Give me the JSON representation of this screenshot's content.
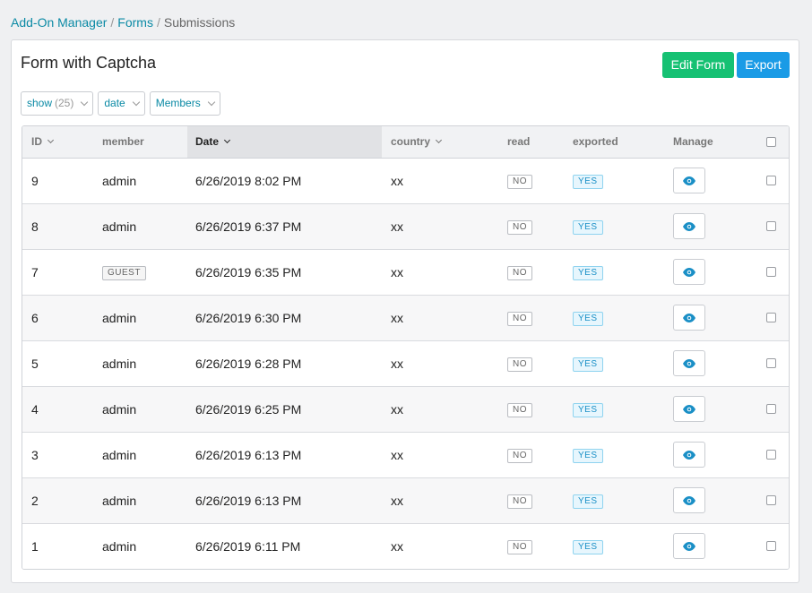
{
  "breadcrumb": {
    "item1": "Add-On Manager",
    "item2": "Forms",
    "current": "Submissions",
    "separator": "/"
  },
  "page": {
    "title": "Form with Captcha"
  },
  "buttons": {
    "edit_form": "Edit Form",
    "export": "Export"
  },
  "filters": {
    "show_label": "show",
    "show_count": "(25)",
    "date_label": "date",
    "members_label": "Members"
  },
  "columns": {
    "id": "ID",
    "member": "member",
    "date": "Date",
    "country": "country",
    "read": "read",
    "exported": "exported",
    "manage": "Manage"
  },
  "rows": [
    {
      "id": "9",
      "member": "admin",
      "date": "6/26/2019 8:02 PM",
      "country": "xx",
      "read": "NO",
      "exported": "YES"
    },
    {
      "id": "8",
      "member": "admin",
      "date": "6/26/2019 6:37 PM",
      "country": "xx",
      "read": "NO",
      "exported": "YES"
    },
    {
      "id": "7",
      "member": "GUEST",
      "member_badge": true,
      "date": "6/26/2019 6:35 PM",
      "country": "xx",
      "read": "NO",
      "exported": "YES"
    },
    {
      "id": "6",
      "member": "admin",
      "date": "6/26/2019 6:30 PM",
      "country": "xx",
      "read": "NO",
      "exported": "YES"
    },
    {
      "id": "5",
      "member": "admin",
      "date": "6/26/2019 6:28 PM",
      "country": "xx",
      "read": "NO",
      "exported": "YES"
    },
    {
      "id": "4",
      "member": "admin",
      "date": "6/26/2019 6:25 PM",
      "country": "xx",
      "read": "NO",
      "exported": "YES"
    },
    {
      "id": "3",
      "member": "admin",
      "date": "6/26/2019 6:13 PM",
      "country": "xx",
      "read": "NO",
      "exported": "YES"
    },
    {
      "id": "2",
      "member": "admin",
      "date": "6/26/2019 6:13 PM",
      "country": "xx",
      "read": "NO",
      "exported": "YES"
    },
    {
      "id": "1",
      "member": "admin",
      "date": "6/26/2019 6:11 PM",
      "country": "xx",
      "read": "NO",
      "exported": "YES"
    }
  ],
  "icons": {
    "view": "eye-icon",
    "sort": "chevron-down-icon"
  },
  "colors": {
    "link": "#0b8aa5",
    "edit_button": "#16c173",
    "export_button": "#1a9be6"
  }
}
